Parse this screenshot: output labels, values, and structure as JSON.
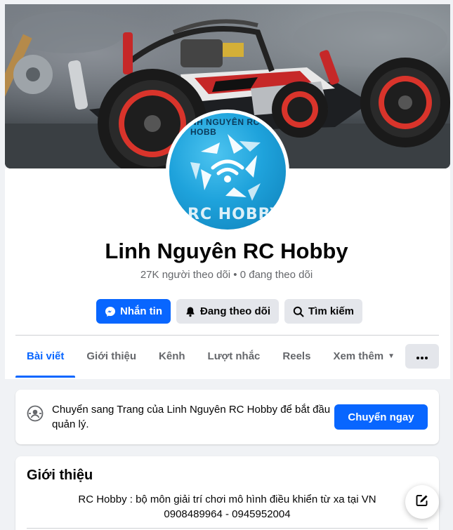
{
  "profile": {
    "name": "Linh Nguyên RC Hobby",
    "stats": "27K người theo dõi • 0 đang theo dõi",
    "avatar_text": "RC HOBBY",
    "avatar_top_text": "NH NGUYÊN RC HOBB"
  },
  "actions": {
    "message": "Nhắn tin",
    "following": "Đang theo dõi",
    "search": "Tìm kiếm"
  },
  "tabs": [
    {
      "label": "Bài viết",
      "active": true
    },
    {
      "label": "Giới thiệu",
      "active": false
    },
    {
      "label": "Kênh",
      "active": false
    },
    {
      "label": "Lượt nhắc",
      "active": false
    },
    {
      "label": "Reels",
      "active": false
    },
    {
      "label": "Xem thêm",
      "active": false
    }
  ],
  "switch_card": {
    "text": "Chuyển sang Trang của Linh Nguyên RC Hobby để bắt đầu quản lý.",
    "button": "Chuyển ngay"
  },
  "intro": {
    "title": "Giới thiệu",
    "bio_line1": "RC Hobby : bộ môn giải trí chơi mô hình điều khiển từ xa tại VN",
    "bio_line2": "0908489964 - 0945952004"
  },
  "icons": {
    "message": "messenger-icon",
    "following": "bell-icon",
    "search": "search-icon",
    "more": "more-dots-icon",
    "switch": "profile-switch-icon",
    "fab": "compose-icon",
    "tab_more": "caret-down-icon"
  },
  "colors": {
    "primary": "#0866ff",
    "secondary_bg": "#e4e6eb",
    "text_muted": "#65676b",
    "page_bg": "#f0f2f5"
  }
}
